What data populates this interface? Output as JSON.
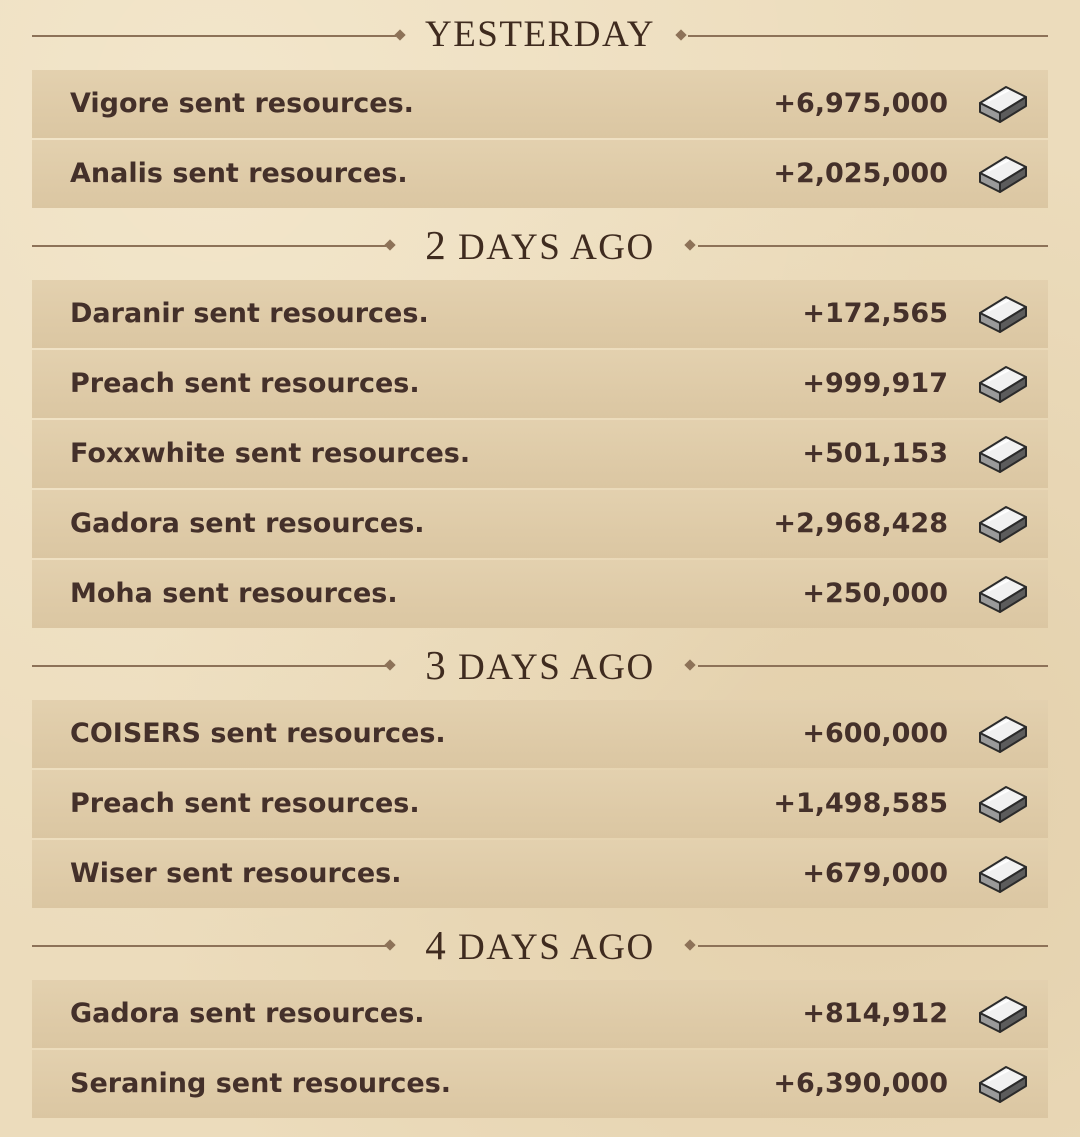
{
  "sections": [
    {
      "heading": "YESTERDAY",
      "entries": [
        {
          "text": "Vigore sent resources.",
          "amount": "+6,975,000",
          "icon": "silver-ingot-icon"
        },
        {
          "text": "Analis sent resources.",
          "amount": "+2,025,000",
          "icon": "silver-ingot-icon"
        }
      ]
    },
    {
      "heading_num": "2",
      "heading_rest": "DAYS AGO",
      "entries": [
        {
          "text": "Daranir sent resources.",
          "amount": "+172,565",
          "icon": "silver-ingot-icon"
        },
        {
          "text": "Preach sent resources.",
          "amount": "+999,917",
          "icon": "silver-ingot-icon"
        },
        {
          "text": "Foxxwhite sent resources.",
          "amount": "+501,153",
          "icon": "silver-ingot-icon"
        },
        {
          "text": "Gadora sent resources.",
          "amount": "+2,968,428",
          "icon": "silver-ingot-icon"
        },
        {
          "text": "Moha sent resources.",
          "amount": "+250,000",
          "icon": "silver-ingot-icon"
        }
      ]
    },
    {
      "heading_num": "3",
      "heading_rest": "DAYS AGO",
      "entries": [
        {
          "text": "COISERS sent resources.",
          "amount": "+600,000",
          "icon": "silver-ingot-icon"
        },
        {
          "text": "Preach sent resources.",
          "amount": "+1,498,585",
          "icon": "silver-ingot-icon"
        },
        {
          "text": "Wiser sent resources.",
          "amount": "+679,000",
          "icon": "silver-ingot-icon"
        }
      ]
    },
    {
      "heading_num": "4",
      "heading_rest": "DAYS AGO",
      "entries": [
        {
          "text": "Gadora sent resources.",
          "amount": "+814,912",
          "icon": "silver-ingot-icon"
        },
        {
          "text": "Seraning sent resources.",
          "amount": "+6,390,000",
          "icon": "silver-ingot-icon"
        }
      ]
    }
  ]
}
